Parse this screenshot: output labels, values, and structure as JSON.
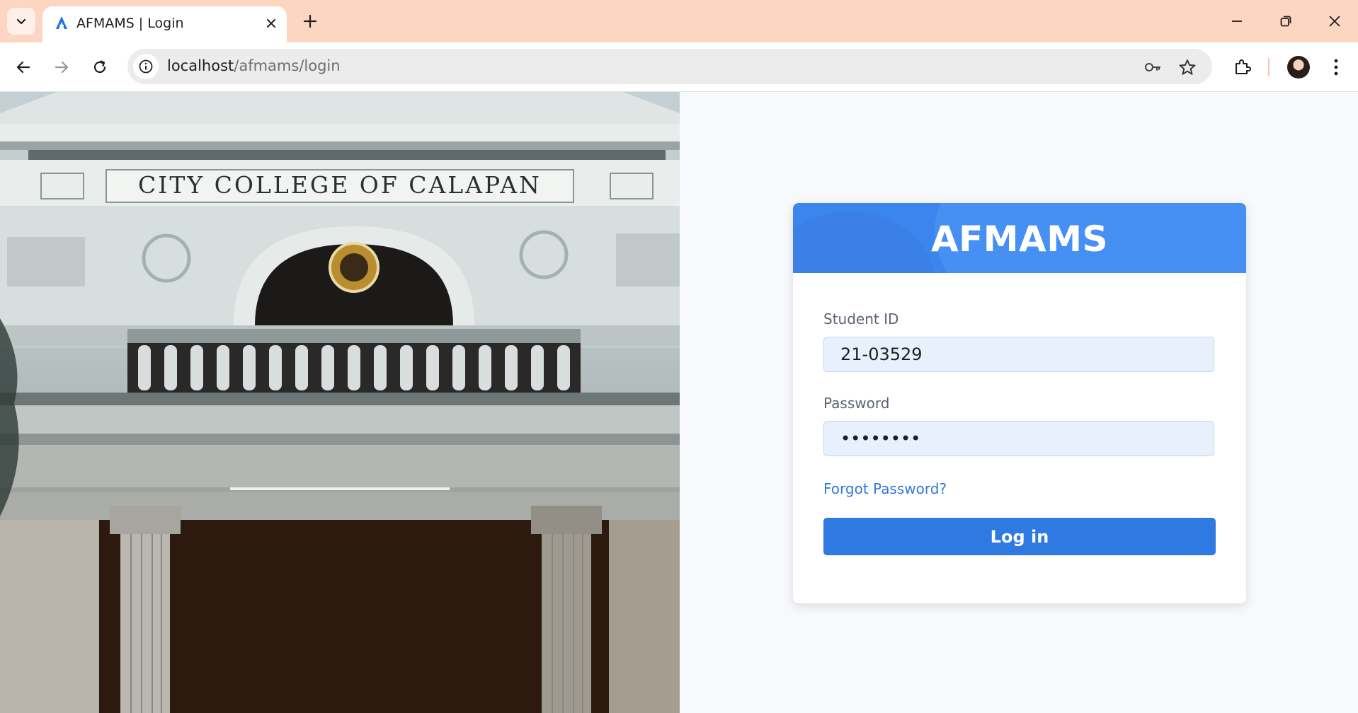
{
  "browser": {
    "tab_title": "AFMAMS | Login",
    "url_host": "localhost",
    "url_path": "/afmams/login",
    "icons": [
      "tab-list-icon",
      "favicon-icon",
      "close-tab-icon",
      "new-tab-icon",
      "minimize-icon",
      "restore-icon",
      "close-window-icon",
      "back-icon",
      "forward-icon",
      "reload-icon",
      "site-info-icon",
      "password-key-icon",
      "bookmark-star-icon",
      "extensions-icon",
      "profile-avatar",
      "menu-dots-icon"
    ]
  },
  "hero": {
    "building_sign": "CITY COLLEGE OF CALAPAN"
  },
  "login": {
    "title": "AFMAMS",
    "student_id_label": "Student ID",
    "student_id_value": "21-03529",
    "password_label": "Password",
    "password_value": "12345678",
    "forgot_label": "Forgot Password?",
    "login_label": "Log in"
  },
  "colors": {
    "tabbar": "#fdd6c2",
    "header_blue": "#3b85ee",
    "button_blue": "#2f79e3",
    "link_blue": "#3478d8",
    "input_bg": "#e8f0fe"
  }
}
